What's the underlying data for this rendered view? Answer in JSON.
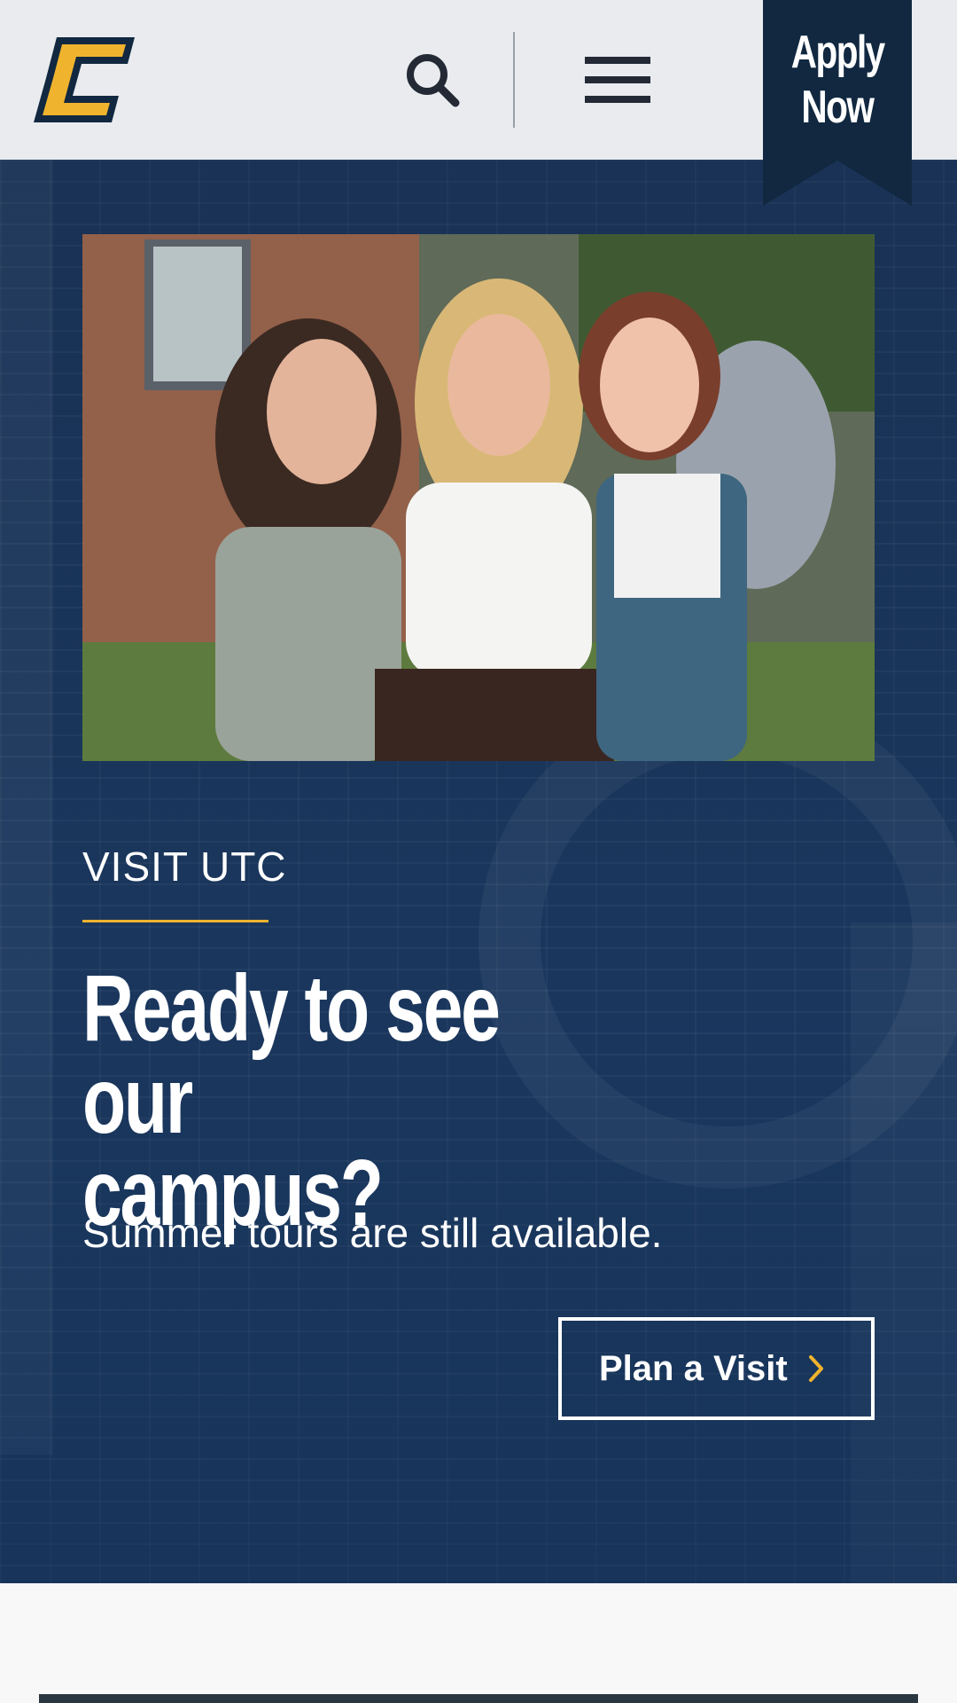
{
  "header": {
    "logo_alt": "UTC",
    "apply_line1": "Apply",
    "apply_line2": "Now"
  },
  "hero": {
    "eyebrow": "VISIT UTC",
    "headline_line1": "Ready to see our",
    "headline_line2": "campus?",
    "subtext": "Summer tours are still available.",
    "cta_label": "Plan a Visit"
  },
  "colors": {
    "navy": "#112840",
    "gold": "#f0b32e",
    "header_bg": "#e9ebee"
  }
}
